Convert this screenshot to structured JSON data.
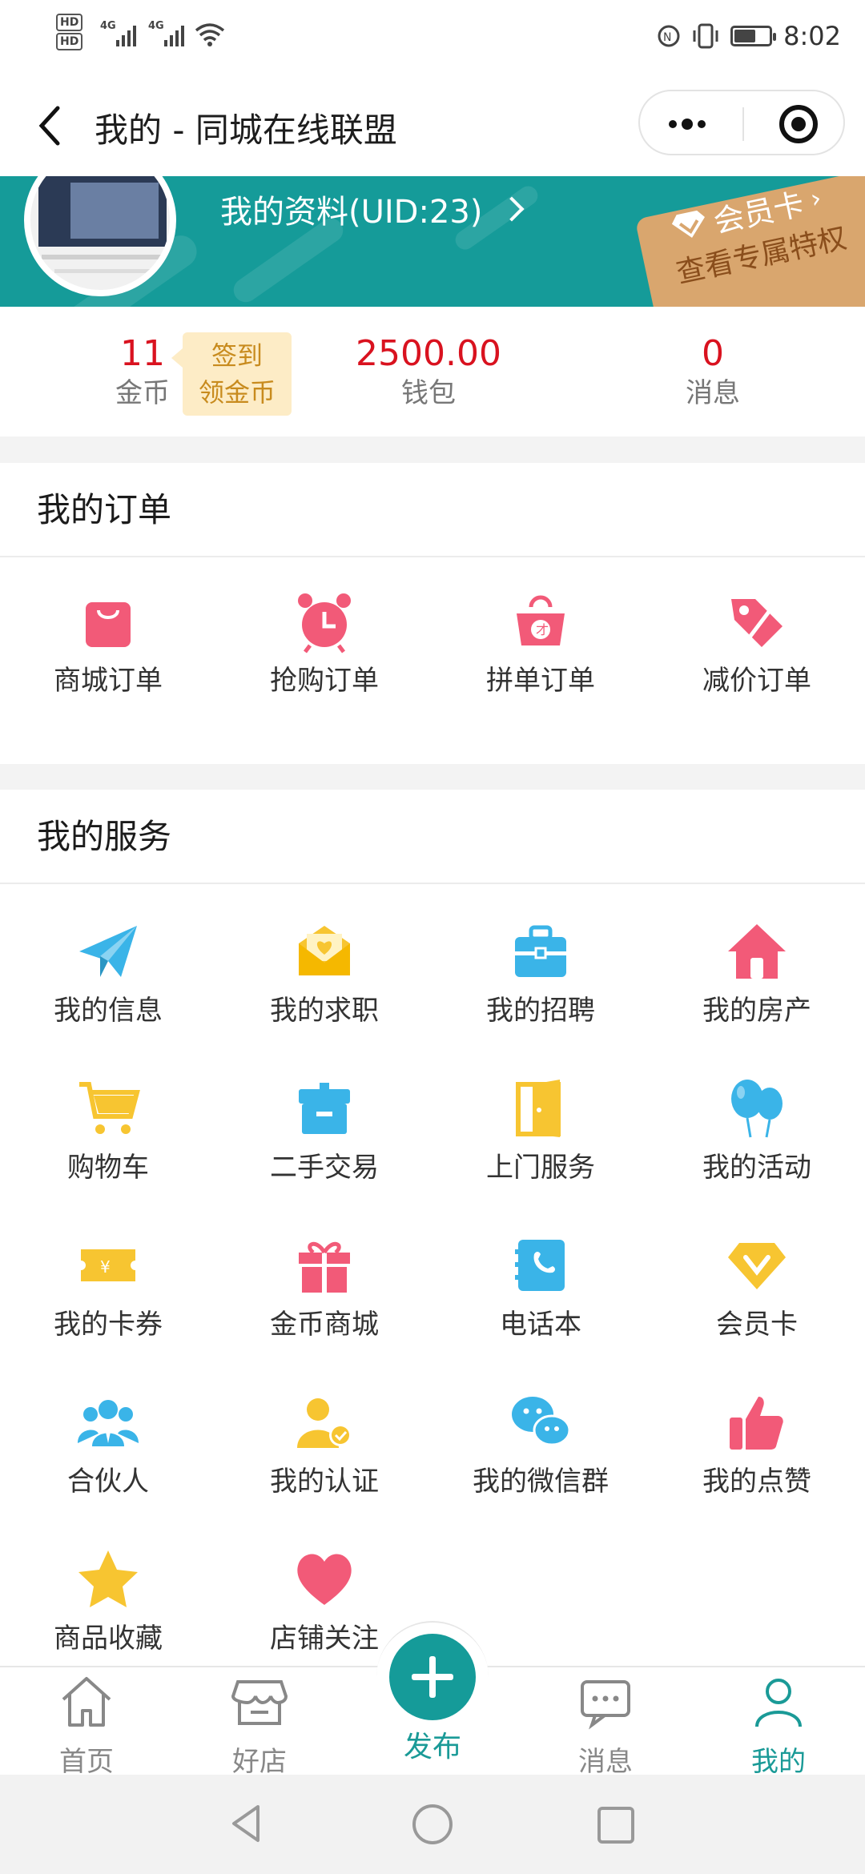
{
  "status_bar": {
    "hd1": "HD",
    "hd2": "HD",
    "net1": "4G",
    "net2": "4G",
    "time": "8:02"
  },
  "nav": {
    "title": "我的 - 同城在线联盟"
  },
  "banner": {
    "profile_label": "我的资料(UID:23)",
    "vip_title": "会员卡",
    "vip_subtitle": "查看专属特权"
  },
  "stats": {
    "coins_value": "11",
    "coins_label": "金币",
    "checkin_line1": "签到",
    "checkin_line2": "领金币",
    "wallet_value": "2500.00",
    "wallet_label": "钱包",
    "messages_value": "0",
    "messages_label": "消息"
  },
  "orders": {
    "title": "我的订单",
    "items": [
      {
        "label": "商城订单",
        "icon": "shopping-bag-icon"
      },
      {
        "label": "抢购订单",
        "icon": "alarm-clock-icon"
      },
      {
        "label": "拼单订单",
        "icon": "group-bag-icon"
      },
      {
        "label": "减价订单",
        "icon": "discount-tag-icon"
      }
    ]
  },
  "services": {
    "title": "我的服务",
    "items": [
      {
        "label": "我的信息",
        "icon": "paper-plane-icon"
      },
      {
        "label": "我的求职",
        "icon": "envelope-heart-icon"
      },
      {
        "label": "我的招聘",
        "icon": "briefcase-icon"
      },
      {
        "label": "我的房产",
        "icon": "house-icon"
      },
      {
        "label": "购物车",
        "icon": "cart-icon"
      },
      {
        "label": "二手交易",
        "icon": "box-icon"
      },
      {
        "label": "上门服务",
        "icon": "door-icon"
      },
      {
        "label": "我的活动",
        "icon": "balloons-icon"
      },
      {
        "label": "我的卡券",
        "icon": "coupon-icon"
      },
      {
        "label": "金币商城",
        "icon": "gift-icon"
      },
      {
        "label": "电话本",
        "icon": "phonebook-icon"
      },
      {
        "label": "会员卡",
        "icon": "diamond-icon"
      },
      {
        "label": "合伙人",
        "icon": "partners-icon"
      },
      {
        "label": "我的认证",
        "icon": "verified-user-icon"
      },
      {
        "label": "我的微信群",
        "icon": "wechat-icon"
      },
      {
        "label": "我的点赞",
        "icon": "thumbs-up-icon"
      },
      {
        "label": "商品收藏",
        "icon": "star-icon"
      },
      {
        "label": "店铺关注",
        "icon": "heart-icon"
      }
    ]
  },
  "tabbar": {
    "home": "首页",
    "shops": "好店",
    "publish": "发布",
    "messages": "消息",
    "mine": "我的"
  },
  "colors": {
    "brand": "#159b99",
    "price_red": "#d9121f",
    "pink": "#f25a78",
    "blue": "#3ab4e8",
    "yellow": "#f7c531"
  }
}
